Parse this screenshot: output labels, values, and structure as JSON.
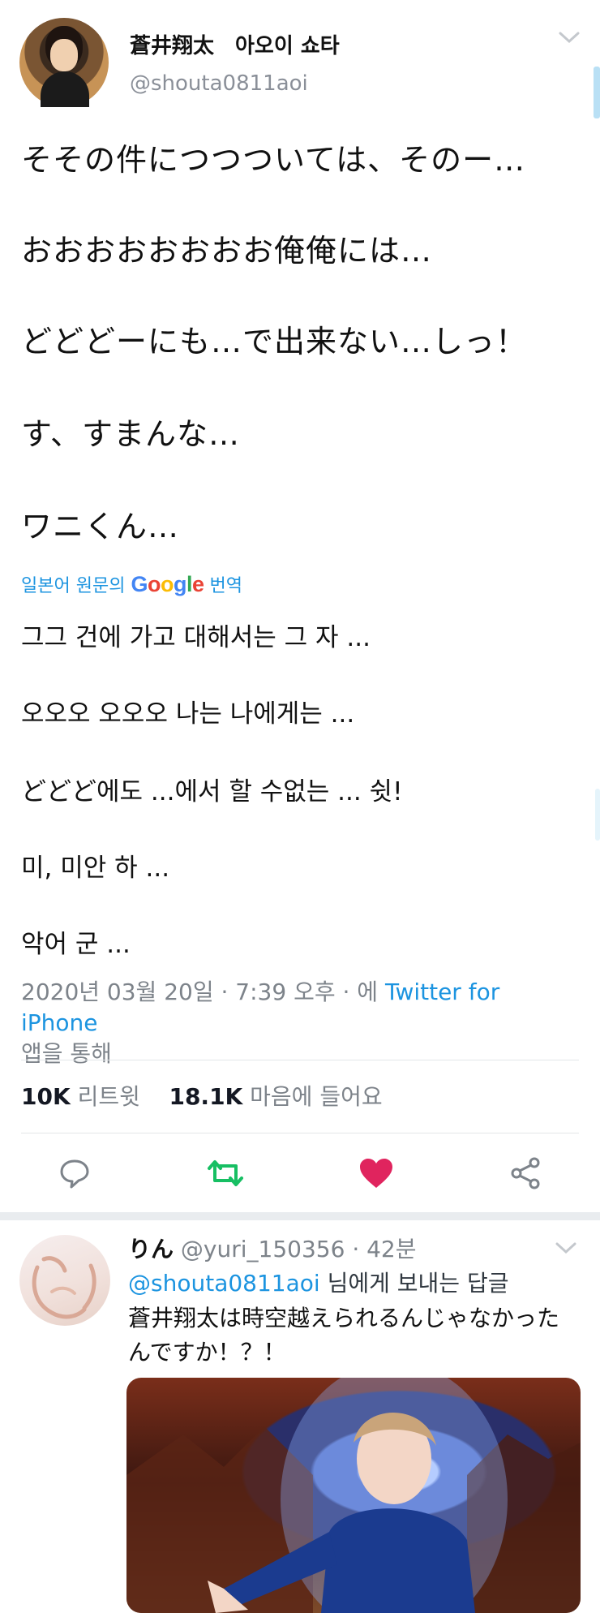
{
  "header": {
    "display_name": "蒼井翔太　아오이 쇼타",
    "handle": "@shouta0811aoi",
    "menu_icon": "chevron-down-icon"
  },
  "tweet": {
    "lines": [
      "そその件につつついては、そのー…",
      "おおおおおおおお俺俺には…",
      "どどどーにも…で出来ない…しっ！",
      "す、すまんな…",
      "ワニくん…"
    ],
    "translation_label_prefix": "일본어 원문의",
    "translation_brand": "Google",
    "translation_label_suffix": "번역",
    "translated_lines": [
      "그그 건에 가고 대해서는 그 자 ...",
      " 오오오 오오오 나는 나에게는 ...",
      "どどど에도 ...에서 할 수없는 ... 쉿!",
      " 미, 미안 하 ...",
      " 악어 군 ..."
    ],
    "timestamp": "2020년 03월 20일 · 7:39 오후 · 에",
    "source": "Twitter for iPhone",
    "source_suffix": "앱을 통해",
    "retweets_count": "10K",
    "retweets_label": "리트윗",
    "likes_count": "18.1K",
    "likes_label": "마음에 들어요"
  },
  "actions": {
    "reply_icon": "reply-icon",
    "retweet_icon": "retweet-icon",
    "like_icon": "heart-icon",
    "share_icon": "share-icon"
  },
  "colors": {
    "link": "#1c94e0",
    "retweet": "#17bf63",
    "like": "#e0245e",
    "muted": "#7d838a"
  },
  "reply": {
    "name": "りん",
    "handle_time": "@yuri_150356 · 42분",
    "reply_to_handle": "@shouta0811aoi",
    "reply_to_suffix": " 님에게 보내는 답글",
    "text": "蒼井翔太は時空越えられるんじゃなかったんですか！？！"
  }
}
